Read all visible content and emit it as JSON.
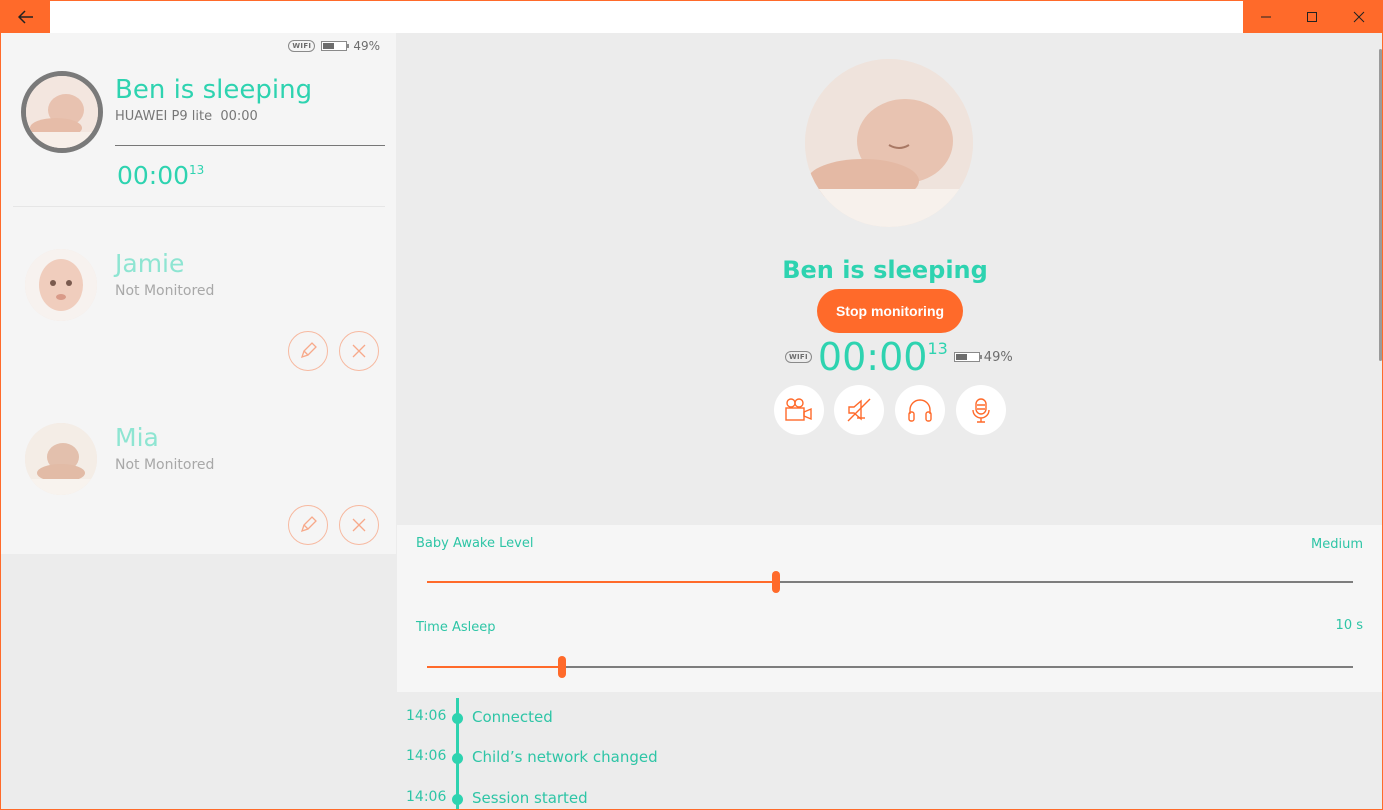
{
  "titlebar": {
    "back_icon": "arrow-left-icon",
    "min_icon": "minimize-icon",
    "max_icon": "maximize-icon",
    "close_icon": "close-icon"
  },
  "colors": {
    "accent": "#ff6a2a",
    "teal": "#2ed3b0",
    "panel": "#f5f5f5"
  },
  "left": {
    "status": {
      "wifi": "WIFI",
      "battery": "49%",
      "battery_level": 0.49
    },
    "active": {
      "name": "Ben is sleeping",
      "device": "HUAWEI P9 lite",
      "device_time": "00:00",
      "timer_main": "00:00",
      "timer_sup": "13"
    },
    "children": [
      {
        "name": "Jamie",
        "status": "Not Monitored",
        "edit_icon": "pencil-icon",
        "remove_icon": "close-icon"
      },
      {
        "name": "Mia",
        "status": "Not Monitored",
        "edit_icon": "pencil-icon",
        "remove_icon": "close-icon"
      }
    ]
  },
  "hero": {
    "name": "Ben is sleeping",
    "stop_label": "Stop monitoring",
    "wifi": "WIFI",
    "timer_main": "00:00",
    "timer_sup": "13",
    "battery": "49%",
    "battery_level": 0.49,
    "controls": [
      "video-camera-icon",
      "speaker-muted-icon",
      "headphones-icon",
      "microphone-icon"
    ]
  },
  "sliders": {
    "awake": {
      "label": "Baby Awake Level",
      "value_text": "Medium",
      "level": 0.377
    },
    "asleep": {
      "label": "Time Asleep",
      "value_text": "10 s",
      "level": 0.146
    }
  },
  "timeline": [
    {
      "time": "14:06",
      "text": "Connected"
    },
    {
      "time": "14:06",
      "text": "Child’s network changed"
    },
    {
      "time": "14:06",
      "text": "Session started"
    }
  ]
}
